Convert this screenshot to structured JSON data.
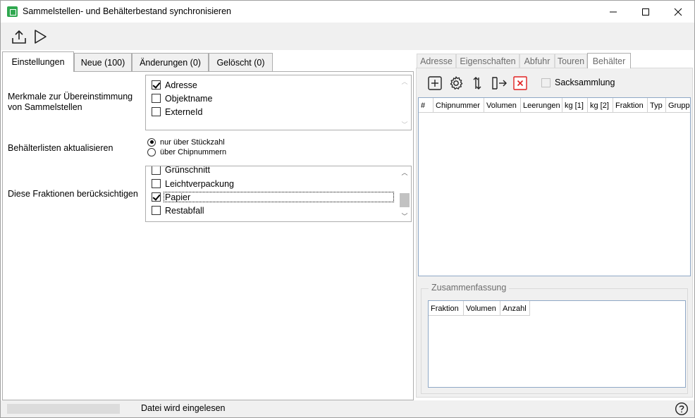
{
  "window": {
    "title": "Sammelstellen- und Behälterbestand synchronisieren",
    "controls": [
      "minimize",
      "maximize",
      "close"
    ]
  },
  "toolbar": {
    "buttons": [
      {
        "icon": "upload-icon",
        "name": "upload"
      },
      {
        "icon": "play-icon",
        "name": "run"
      }
    ]
  },
  "left_tabs": [
    {
      "label": "Einstellungen",
      "active": true
    },
    {
      "label": "Neue (100)",
      "active": false
    },
    {
      "label": "Änderungen (0)",
      "active": false
    },
    {
      "label": "Gelöscht (0)",
      "active": false
    }
  ],
  "settings": {
    "match_label": "Merkmale zur Übereinstimmung von Sammelstellen",
    "match_items": [
      {
        "label": "Adresse",
        "checked": true
      },
      {
        "label": "Objektname",
        "checked": false
      },
      {
        "label": "ExterneId",
        "checked": false
      }
    ],
    "update_label": "Behälterlisten aktualisieren",
    "update_options": [
      {
        "label": "nur über Stückzahl",
        "selected": true
      },
      {
        "label": "über Chipnummern",
        "selected": false
      }
    ],
    "fractions_label": "Diese Fraktionen berücksichtigen",
    "fractions_items": [
      {
        "label": "Grünschnitt",
        "checked": false
      },
      {
        "label": "Leichtverpackung",
        "checked": false
      },
      {
        "label": "Papier",
        "checked": true,
        "focused": true
      },
      {
        "label": "Restabfall",
        "checked": false
      }
    ]
  },
  "right_tabs": [
    {
      "label": "Adresse",
      "active": false
    },
    {
      "label": "Eigenschaften",
      "active": false
    },
    {
      "label": "Abfuhr",
      "active": false
    },
    {
      "label": "Touren",
      "active": false
    },
    {
      "label": "Behälter",
      "active": true
    }
  ],
  "behaelter": {
    "tools": [
      "add-icon",
      "gear-icon",
      "sort-icon",
      "export-icon",
      "delete-icon"
    ],
    "sacksammlung_label": "Sacksammlung",
    "sacksammlung_checked": false,
    "columns": [
      "#",
      "Chipnummer",
      "Volumen",
      "Leerungen",
      "kg [1]",
      "kg [2]",
      "Fraktion",
      "Typ",
      "Gruppe"
    ],
    "rows": []
  },
  "summary": {
    "title": "Zusammenfassung",
    "columns": [
      "Fraktion",
      "Volumen",
      "Anzahl"
    ],
    "rows": []
  },
  "status": {
    "text": "Datei wird eingelesen",
    "progress": 0
  },
  "colors": {
    "accent_green": "#2fa84f",
    "delete_red": "#e02020",
    "grid_border": "#8fa8c6"
  }
}
